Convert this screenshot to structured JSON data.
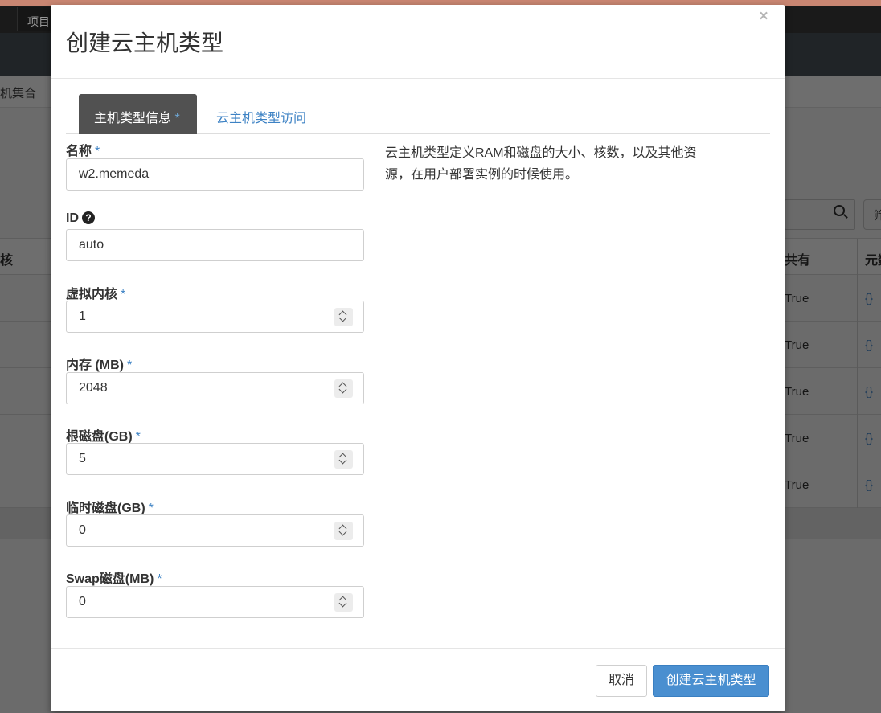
{
  "background": {
    "nav_item": "项目",
    "breadcrumb": "机集合",
    "filter_label": "筛",
    "table_headers": [
      "核",
      "共有",
      "元数据"
    ],
    "rows": [
      {
        "public": "True",
        "metadata": "{}"
      },
      {
        "public": "True",
        "metadata": "{}"
      },
      {
        "public": "True",
        "metadata": "{}"
      },
      {
        "public": "True",
        "metadata": "{}"
      },
      {
        "public": "True",
        "metadata": "{}"
      }
    ]
  },
  "modal": {
    "title": "创建云主机类型",
    "close_symbol": "×",
    "tabs": [
      {
        "label": "主机类型信息",
        "required_mark": "*",
        "active": true
      },
      {
        "label": "云主机类型访问",
        "active": false
      }
    ],
    "fields": {
      "name": {
        "label": "名称",
        "required_mark": "*",
        "value": "w2.memeda"
      },
      "id": {
        "label": "ID",
        "help_symbol": "?",
        "value": "auto"
      },
      "vcpus": {
        "label": "虚拟内核",
        "required_mark": "*",
        "value": "1"
      },
      "ram": {
        "label": "内存 (MB)",
        "required_mark": "*",
        "value": "2048"
      },
      "root_disk": {
        "label": "根磁盘(GB)",
        "required_mark": "*",
        "value": "5"
      },
      "ephemeral_disk": {
        "label": "临时磁盘(GB)",
        "required_mark": "*",
        "value": "0"
      },
      "swap_disk": {
        "label": "Swap磁盘(MB)",
        "required_mark": "*",
        "value": "0"
      }
    },
    "description": "云主机类型定义RAM和磁盘的大小、核数，以及其他资源，在用户部署实例的时候使用。",
    "footer": {
      "cancel_label": "取消",
      "submit_label": "创建云主机类型"
    }
  },
  "colors": {
    "accent": "#4a8fd0",
    "tab_active_bg": "#515151",
    "link": "#3d82c4"
  }
}
